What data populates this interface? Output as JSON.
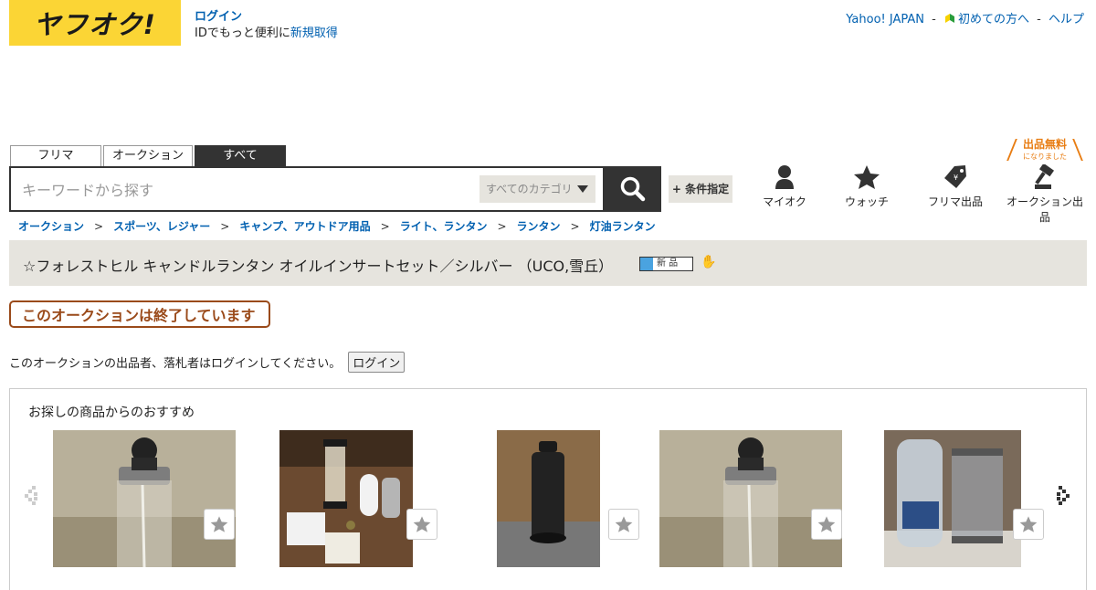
{
  "header": {
    "logo_text": "ヤフオク!",
    "login_label": "ログイン",
    "login_line2_prefix": "IDでもっと便利に",
    "register_label": "新規取得",
    "top_links": [
      "Yahoo! JAPAN",
      "初めての方へ",
      "ヘルプ"
    ],
    "top_sep": "-"
  },
  "search": {
    "tabs": [
      "フリマ",
      "オークション",
      "すべて"
    ],
    "active_tab": "すべて",
    "placeholder": "キーワードから探す",
    "category_label": "すべてのカテゴリ",
    "condition_label": "+ 条件指定"
  },
  "nav": {
    "items": [
      "マイオク",
      "ウォッチ",
      "フリマ出品",
      "オークション出品"
    ],
    "free_badge_main": "出品無料",
    "free_badge_sub": "になりました"
  },
  "breadcrumb": [
    "オークション",
    "スポーツ、レジャー",
    "キャンプ、アウトドア用品",
    "ライト、ランタン",
    "ランタン",
    "灯油ランタン"
  ],
  "breadcrumb_sep": ">",
  "item": {
    "title": "☆フォレストヒル キャンドルランタン オイルインサートセット／シルバー （UCO,雪丘）",
    "new_badge": "新 品"
  },
  "status": {
    "ended": "このオークションは終了しています",
    "login_message": "このオークションの出品者、落札者はログインしてください。",
    "login_button": "ログイン"
  },
  "recommend": {
    "title": "お探しの商品からのおすすめ"
  },
  "colors": {
    "brand_yellow": "#fbd535",
    "link_blue": "#0060b0",
    "ended_brown": "#9a4a1a",
    "accent_orange": "#e87d13",
    "bar_beige": "#e6e4de"
  }
}
